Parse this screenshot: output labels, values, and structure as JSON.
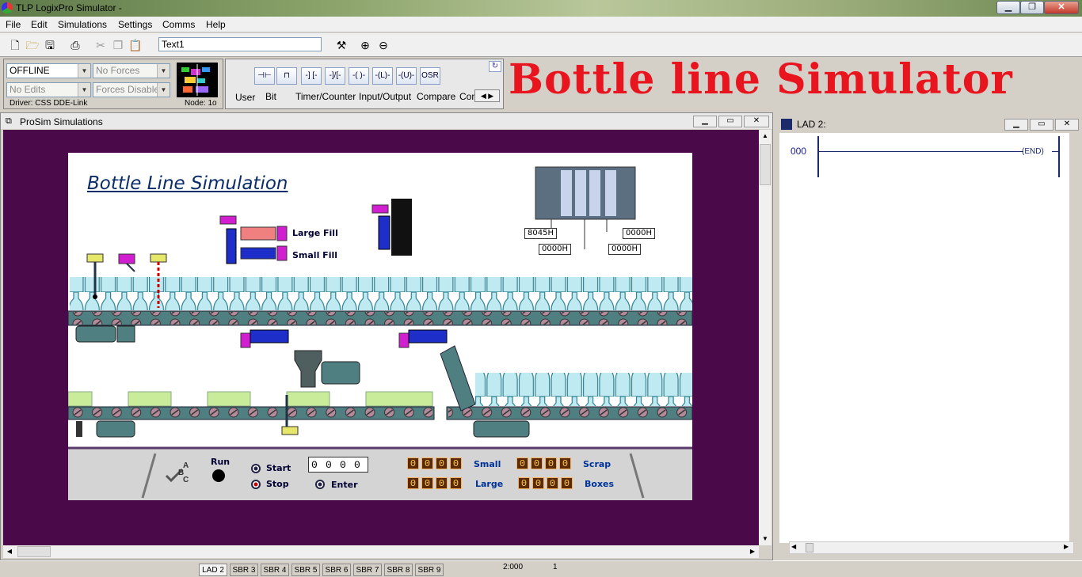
{
  "window": {
    "title": "TLP LogixPro Simulator  -"
  },
  "menu": [
    "File",
    "Edit",
    "Simulations",
    "Settings",
    "Comms",
    "Help"
  ],
  "toolbar": {
    "text_field": "Text1"
  },
  "plc_status": {
    "mode": "OFFLINE",
    "forces": "No Forces",
    "edits": "No Edits",
    "forces_enabled": "Forces Disabled",
    "driver": "Driver: CSS DDE-Link",
    "node": "Node: 1o"
  },
  "instructions": {
    "buttons": [
      "",
      "",
      "",
      "",
      "",
      "",
      "",
      "OSR"
    ],
    "tabs": [
      "User",
      "Bit",
      "Timer/Counter",
      "Input/Output",
      "Compare",
      "Con"
    ]
  },
  "banner": "Bottle line Simulator",
  "prosim": {
    "title": "ProSim Simulations",
    "sim_title": "Bottle Line Simulation",
    "fill_labels": [
      "Large Fill",
      "Small Fill"
    ],
    "rack_values": [
      "8045H",
      "0000H",
      "0000H",
      "0000H"
    ],
    "controls": {
      "abc": [
        "A",
        "B",
        "C"
      ],
      "run": "Run",
      "start": "Start",
      "stop": "Stop",
      "enter": "Enter",
      "thumbwheel": [
        "0",
        "0",
        "0",
        "0"
      ],
      "counters": [
        {
          "label": "Small",
          "digits": [
            "0",
            "0",
            "0",
            "0"
          ]
        },
        {
          "label": "Large",
          "digits": [
            "0",
            "0",
            "0",
            "0"
          ]
        },
        {
          "label": "Scrap",
          "digits": [
            "0",
            "0",
            "0",
            "0"
          ]
        },
        {
          "label": "Boxes",
          "digits": [
            "0",
            "0",
            "0",
            "0"
          ]
        }
      ]
    }
  },
  "ladder": {
    "title": "LAD 2:",
    "rung": "000",
    "end_label": "END"
  },
  "statusbar": {
    "tabs": [
      "LAD 2",
      "SBR 3",
      "SBR 4",
      "SBR 5",
      "SBR 6",
      "SBR 7",
      "SBR 8",
      "SBR 9"
    ],
    "position": "2:000",
    "count": "1"
  },
  "colors": {
    "banner": "#e8141e",
    "background": "#4a0a4a",
    "digit_bg": "#5a2a08",
    "label_text": "#003399"
  }
}
